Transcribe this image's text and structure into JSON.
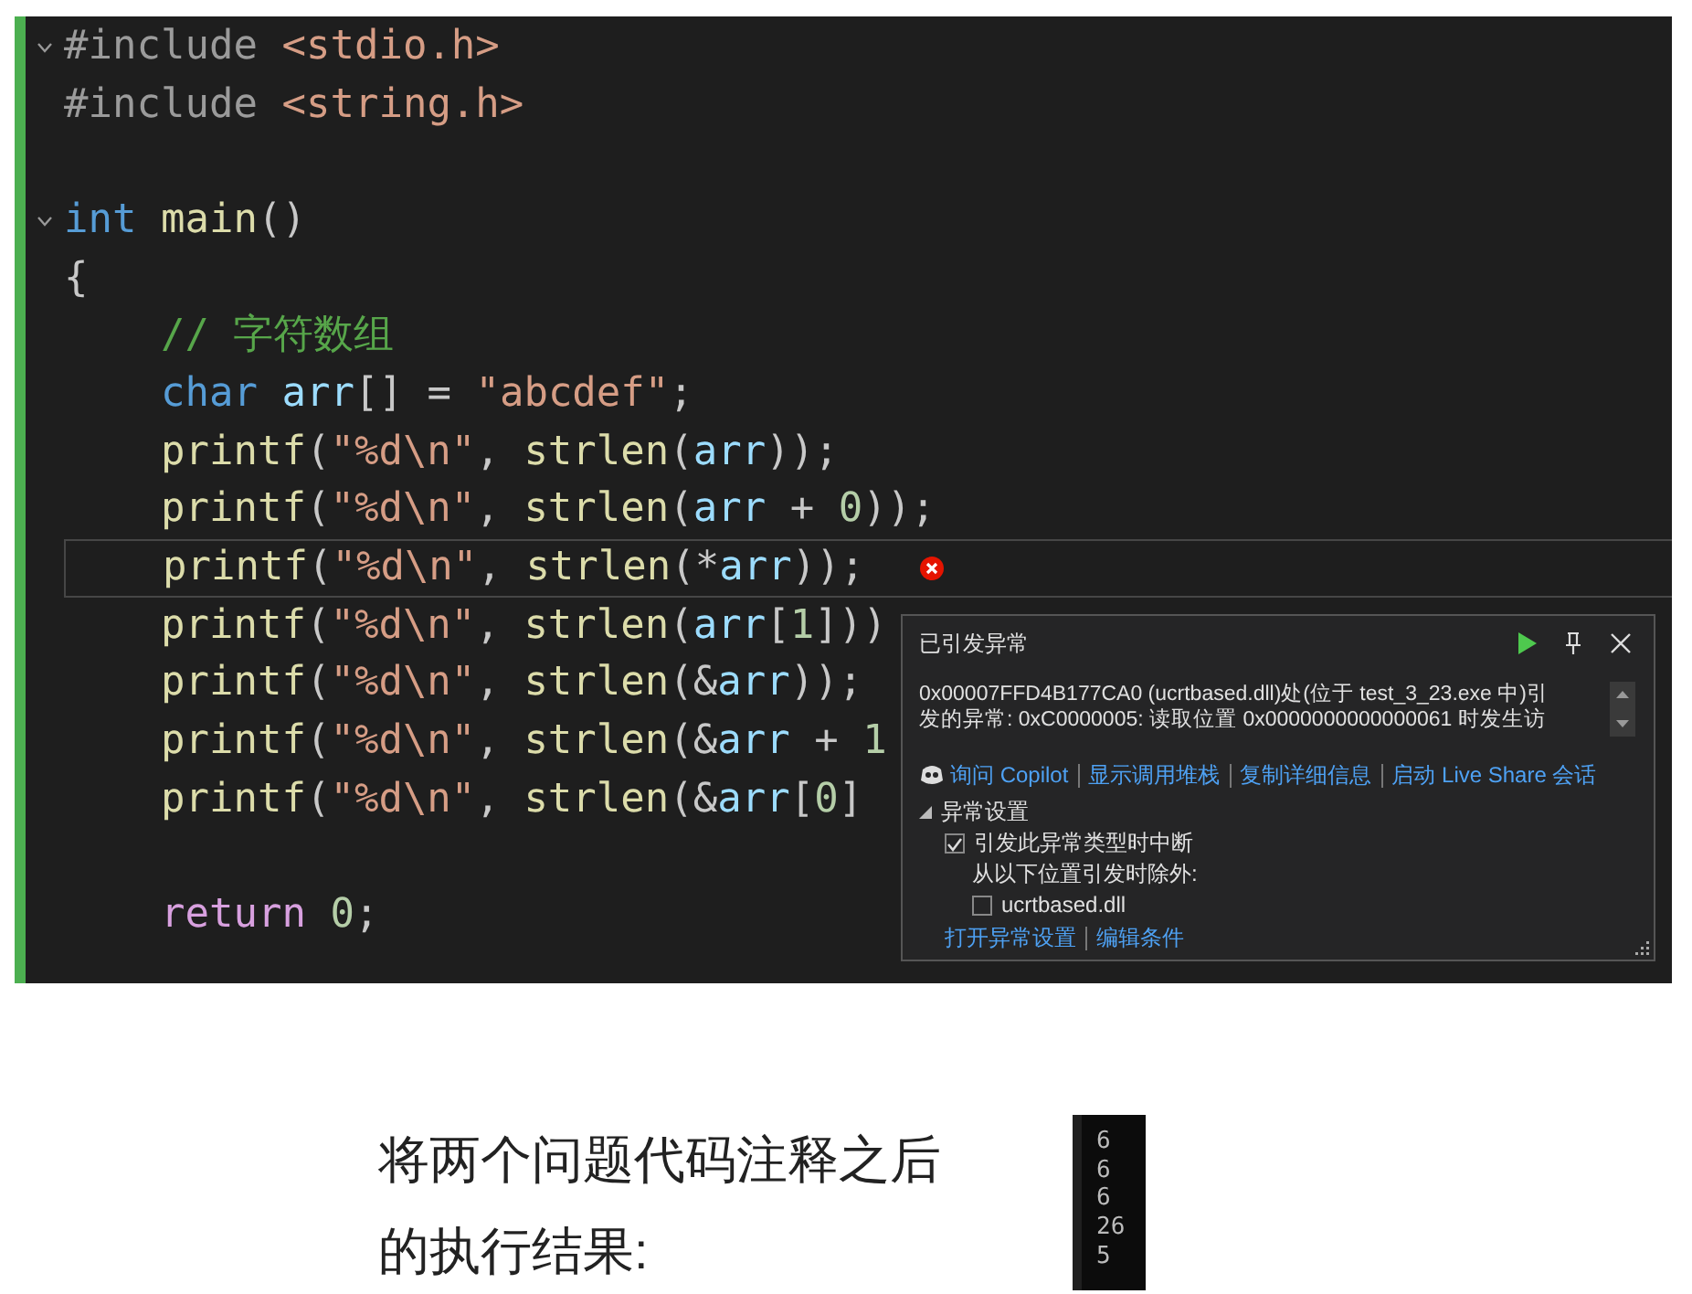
{
  "editor": {
    "lines": [
      {
        "foldable": true,
        "current": false,
        "error": false,
        "tokens": [
          {
            "kind": "preproc",
            "text": "#include "
          },
          {
            "kind": "header",
            "text": "<stdio.h>"
          }
        ]
      },
      {
        "foldable": false,
        "current": false,
        "error": false,
        "tokens": [
          {
            "kind": "preproc",
            "text": "#include "
          },
          {
            "kind": "header",
            "text": "<string.h>"
          }
        ]
      },
      {
        "foldable": false,
        "current": false,
        "error": false
      },
      {
        "foldable": true,
        "current": false,
        "error": false,
        "tokens": [
          {
            "kind": "keyword",
            "text": "int "
          },
          {
            "kind": "func",
            "text": "main"
          },
          {
            "kind": "punct",
            "text": "()"
          }
        ]
      },
      {
        "foldable": false,
        "current": false,
        "error": false,
        "tokens": [
          {
            "kind": "punct",
            "text": "{"
          }
        ]
      },
      {
        "foldable": false,
        "current": false,
        "error": false,
        "tokens": [
          {
            "kind": "comment",
            "text": "    // 字符数组"
          }
        ]
      },
      {
        "foldable": false,
        "current": false,
        "error": false,
        "tokens": [
          {
            "kind": "keyword",
            "text": "    char "
          },
          {
            "kind": "ident",
            "text": "arr"
          },
          {
            "kind": "punct",
            "text": "[] = "
          },
          {
            "kind": "string",
            "text": "\"abcdef\""
          },
          {
            "kind": "punct",
            "text": ";"
          }
        ]
      },
      {
        "foldable": false,
        "current": false,
        "error": false,
        "tokens": [
          {
            "kind": "func",
            "text": "    printf"
          },
          {
            "kind": "punct",
            "text": "("
          },
          {
            "kind": "string",
            "text": "\"%d\\n\""
          },
          {
            "kind": "punct",
            "text": ", "
          },
          {
            "kind": "func",
            "text": "strlen"
          },
          {
            "kind": "punct",
            "text": "("
          },
          {
            "kind": "ident",
            "text": "arr"
          },
          {
            "kind": "punct",
            "text": "));"
          }
        ]
      },
      {
        "foldable": false,
        "current": false,
        "error": false,
        "tokens": [
          {
            "kind": "func",
            "text": "    printf"
          },
          {
            "kind": "punct",
            "text": "("
          },
          {
            "kind": "string",
            "text": "\"%d\\n\""
          },
          {
            "kind": "punct",
            "text": ", "
          },
          {
            "kind": "func",
            "text": "strlen"
          },
          {
            "kind": "punct",
            "text": "("
          },
          {
            "kind": "ident",
            "text": "arr"
          },
          {
            "kind": "punct",
            "text": " + "
          },
          {
            "kind": "number",
            "text": "0"
          },
          {
            "kind": "punct",
            "text": "));"
          }
        ]
      },
      {
        "foldable": false,
        "current": true,
        "error": true,
        "tokens": [
          {
            "kind": "func",
            "text": "    printf"
          },
          {
            "kind": "punct",
            "text": "("
          },
          {
            "kind": "string",
            "text": "\"%d\\n\""
          },
          {
            "kind": "punct",
            "text": ", "
          },
          {
            "kind": "func",
            "text": "strlen"
          },
          {
            "kind": "punct",
            "text": "(*"
          },
          {
            "kind": "ident",
            "text": "arr"
          },
          {
            "kind": "punct",
            "text": "));"
          }
        ]
      },
      {
        "foldable": false,
        "current": false,
        "error": false,
        "tokens": [
          {
            "kind": "func",
            "text": "    printf"
          },
          {
            "kind": "punct",
            "text": "("
          },
          {
            "kind": "string",
            "text": "\"%d\\n\""
          },
          {
            "kind": "punct",
            "text": ", "
          },
          {
            "kind": "func",
            "text": "strlen"
          },
          {
            "kind": "punct",
            "text": "("
          },
          {
            "kind": "ident",
            "text": "arr"
          },
          {
            "kind": "punct",
            "text": "["
          },
          {
            "kind": "number",
            "text": "1"
          },
          {
            "kind": "punct",
            "text": "]))"
          }
        ]
      },
      {
        "foldable": false,
        "current": false,
        "error": false,
        "tokens": [
          {
            "kind": "func",
            "text": "    printf"
          },
          {
            "kind": "punct",
            "text": "("
          },
          {
            "kind": "string",
            "text": "\"%d\\n\""
          },
          {
            "kind": "punct",
            "text": ", "
          },
          {
            "kind": "func",
            "text": "strlen"
          },
          {
            "kind": "punct",
            "text": "(&"
          },
          {
            "kind": "ident",
            "text": "arr"
          },
          {
            "kind": "punct",
            "text": "));"
          }
        ]
      },
      {
        "foldable": false,
        "current": false,
        "error": false,
        "tokens": [
          {
            "kind": "func",
            "text": "    printf"
          },
          {
            "kind": "punct",
            "text": "("
          },
          {
            "kind": "string",
            "text": "\"%d\\n\""
          },
          {
            "kind": "punct",
            "text": ", "
          },
          {
            "kind": "func",
            "text": "strlen"
          },
          {
            "kind": "punct",
            "text": "(&"
          },
          {
            "kind": "ident",
            "text": "arr"
          },
          {
            "kind": "punct",
            "text": " + "
          },
          {
            "kind": "number",
            "text": "1"
          }
        ]
      },
      {
        "foldable": false,
        "current": false,
        "error": false,
        "tokens": [
          {
            "kind": "func",
            "text": "    printf"
          },
          {
            "kind": "punct",
            "text": "("
          },
          {
            "kind": "string",
            "text": "\"%d\\n\""
          },
          {
            "kind": "punct",
            "text": ", "
          },
          {
            "kind": "func",
            "text": "strlen"
          },
          {
            "kind": "punct",
            "text": "(&"
          },
          {
            "kind": "ident",
            "text": "arr"
          },
          {
            "kind": "punct",
            "text": "["
          },
          {
            "kind": "number",
            "text": "0"
          },
          {
            "kind": "punct",
            "text": "]"
          }
        ]
      },
      {
        "foldable": false,
        "current": false,
        "error": false
      },
      {
        "foldable": false,
        "current": false,
        "error": false,
        "tokens": [
          {
            "kind": "keyword2",
            "text": "    return "
          },
          {
            "kind": "number",
            "text": "0"
          },
          {
            "kind": "punct",
            "text": ";"
          }
        ]
      }
    ]
  },
  "exception_popup": {
    "title": "已引发异常",
    "message_lines": [
      "0x00007FFD4B177CA0 (ucrtbased.dll)处(位于 test_3_23.exe 中)引",
      "发的异常: 0xC0000005: 读取位置 0x0000000000000061 时发生访"
    ],
    "actions": [
      "询问 Copilot",
      "显示调用堆栈",
      "复制详细信息",
      "启动 Live Share 会话"
    ],
    "settings": {
      "title": "异常设置",
      "expanded": true,
      "break_option": {
        "label": "引发此异常类型时中断",
        "checked": true
      },
      "except_label": "从以下位置引发时除外:",
      "modules": [
        {
          "label": "ucrtbased.dll",
          "checked": false
        }
      ]
    },
    "footer_links": [
      "打开异常设置",
      "编辑条件"
    ]
  },
  "caption": {
    "lines": [
      "将两个问题代码注释之后",
      "的执行结果:"
    ]
  },
  "console": {
    "lines": [
      "6",
      "6",
      "6",
      "26",
      "5"
    ]
  }
}
